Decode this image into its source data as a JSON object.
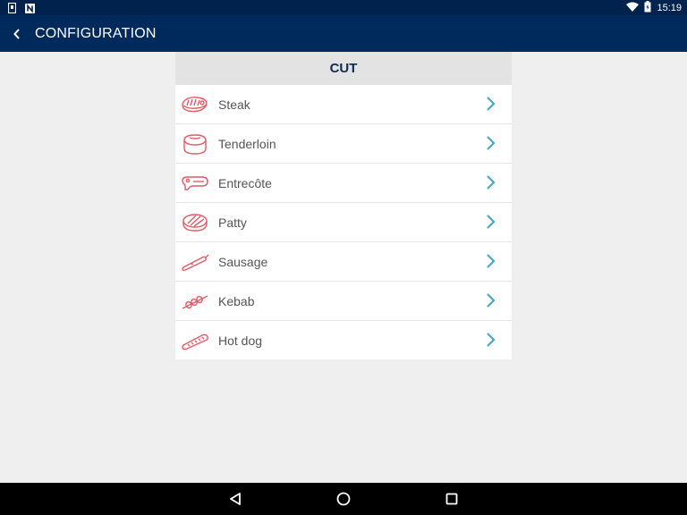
{
  "status_bar": {
    "time": "15:19",
    "icons": [
      "sim-icon",
      "n-notification-icon",
      "wifi-icon",
      "battery-icon"
    ]
  },
  "app_bar": {
    "title": "CONFIGURATION",
    "back_icon": "chevron-left-icon"
  },
  "panel": {
    "header": "CUT",
    "items": [
      {
        "label": "Steak",
        "icon": "steak-icon"
      },
      {
        "label": "Tenderloin",
        "icon": "tenderloin-icon"
      },
      {
        "label": "Entrecôte",
        "icon": "entrecote-icon"
      },
      {
        "label": "Patty",
        "icon": "patty-icon"
      },
      {
        "label": "Sausage",
        "icon": "sausage-icon"
      },
      {
        "label": "Kebab",
        "icon": "kebab-icon"
      },
      {
        "label": "Hot dog",
        "icon": "hot-dog-icon"
      }
    ]
  },
  "nav_bar": {
    "buttons": [
      "back-triangle-icon",
      "home-circle-icon",
      "recents-square-icon"
    ]
  },
  "colors": {
    "status_bar": "#00224d",
    "app_bar": "#00295c",
    "background": "#efefef",
    "panel_header": "#e3e3e3",
    "header_text": "#0e2a55",
    "icon_red": "#e05a66",
    "chevron_blue": "#4aa8c9"
  }
}
